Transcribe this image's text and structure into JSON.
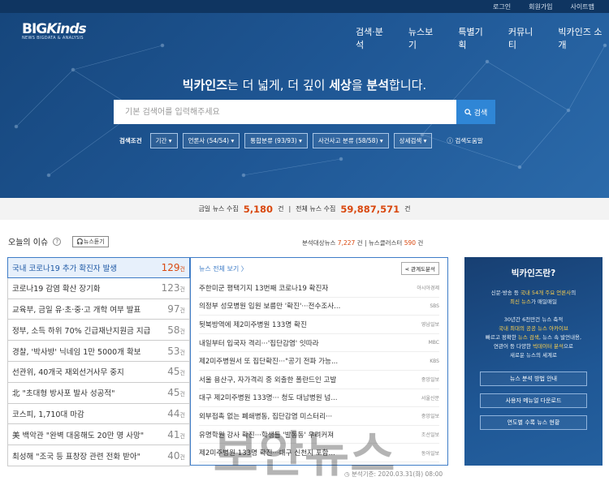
{
  "topbar": {
    "links": [
      "로그인",
      "회원가입",
      "사이트맵"
    ]
  },
  "logo": {
    "brand_main": "BIG",
    "brand_italic": "Kinds",
    "tagline": "NEWS BIGDATA & ANALYSIS"
  },
  "nav": {
    "items": [
      "검색·분석",
      "뉴스보기",
      "특별기획",
      "커뮤니티",
      "빅카인즈 소개"
    ]
  },
  "hero": {
    "headline_parts": [
      "빅카인즈",
      "는 더 넓게, 더 깊이 ",
      "세상",
      "을 ",
      "분석",
      "합니다."
    ]
  },
  "search": {
    "placeholder": "기본 검색어를 입력해주세요",
    "value": "",
    "button_label": "검색"
  },
  "conditions": {
    "label": "검색조건",
    "chips": [
      "기간 ▾",
      "언론사 (54/54) ▾",
      "통합분류 (93/93) ▾",
      "사건사고 분류 (58/58) ▾",
      "상세검색 ▾"
    ],
    "help_label": "검색도움말"
  },
  "stats": {
    "today_label": "금일 뉴스 수집",
    "today_value": "5,180",
    "unit": "건",
    "total_label": "전체 뉴스 수집",
    "total_value": "59,887,571",
    "separator": "|"
  },
  "today_issue": {
    "title": "오늘의 이슈",
    "listen_label": "뉴스듣기",
    "meta_label1": "분석대상뉴스",
    "meta_value1": "7,227",
    "meta_label2": "뉴스클러스터",
    "meta_value2": "590",
    "unit": "건",
    "items": [
      {
        "label": "국내 코로나19 추가 확진자 발생",
        "count": "129"
      },
      {
        "label": "코로나19 감염 확산 장기화",
        "count": "123"
      },
      {
        "label": "교육부, 금일 유·초·중·고 개학 여부 발표",
        "count": "97"
      },
      {
        "label": "정부, 소득 하위 70% 긴급재난지원금 지급",
        "count": "58"
      },
      {
        "label": "경찰, '박사방' 닉네임 1만 5000개 확보",
        "count": "53"
      },
      {
        "label": "선관위, 40개국 재외선거사무 중지",
        "count": "45"
      },
      {
        "label": "北 \"초대형 방사포 발사 성공적\"",
        "count": "45"
      },
      {
        "label": "코스피, 1,710대 마감",
        "count": "44"
      },
      {
        "label": "美 백악관 \"완벽 대응해도 20만 명 사망\"",
        "count": "41"
      },
      {
        "label": "최성해 \"조국 등 표창장 관련 전화 받아\"",
        "count": "40"
      }
    ]
  },
  "news_panel": {
    "all_label": "뉴스 전체 보기 〉",
    "relation_label": "관계도분석",
    "items": [
      {
        "title": "주한미군 평택기지 13번째 코로나19 확진자",
        "source": "아시아경제"
      },
      {
        "title": "의정부 성모병원 입원 보름만 '확진'···전수조사...",
        "source": "SBS"
      },
      {
        "title": "뒷북방역에 제2미주병원 133명 확진",
        "source": "영남일보"
      },
      {
        "title": "내일부터 입국자 격리···'집단감염' 잇따라",
        "source": "MBC"
      },
      {
        "title": "제2미주병원서 또 집단확진···\"공기 전파 가능...",
        "source": "KBS"
      },
      {
        "title": "서울 용산구, 자가격리 중 외출한 폴란드인 고발",
        "source": "중앙일보"
      },
      {
        "title": "대구 제2미주병원 133명··· 청도 대남병원 넘...",
        "source": "서울신문"
      },
      {
        "title": "외부접촉 없는 폐쇄병동, 집단감염 미스터리···",
        "source": "중앙일보"
      },
      {
        "title": "유명학원 강사 확진···학생들 '발동동' 우려커져",
        "source": "조선일보"
      },
      {
        "title": "제2미주병원 133명 확진···대구 신천지 포함...",
        "source": "동아일보"
      }
    ]
  },
  "sidebox": {
    "title": "빅카인즈란?",
    "desc1a": "신문·방송 등 ",
    "desc1b": "국내 54개 주요 언론사",
    "desc1c": "의",
    "desc2a": "최신 뉴스",
    "desc2b": "가 매일매일",
    "desc3": "30년간 6천만건 뉴스 축적",
    "desc4": "국내 최대의 공공 뉴스 아카이브",
    "desc5a": "빠르고 정확한 ",
    "desc5b": "뉴스 검색",
    "desc5c": ", 뉴스 속 발언내용,",
    "desc6a": "연관어 등 다양한 ",
    "desc6b": "빅데이터 분석",
    "desc6c": "으로",
    "desc7": "새로운 뉴스의 세계로",
    "buttons": [
      "뉴스 분석 방법 안내",
      "사용자 메뉴얼 다운로드",
      "연도별 수록 뉴스 현황"
    ]
  },
  "footer": {
    "analysis_time": "분석기준: 2020.03.31(화) 08:00"
  },
  "watermark": {
    "text": "보안뉴스"
  },
  "colors": {
    "hero_blue": "#1f5795",
    "accent_orange": "#d9480f",
    "link_blue": "#3e7cc7",
    "yellow": "#ffd24c"
  }
}
